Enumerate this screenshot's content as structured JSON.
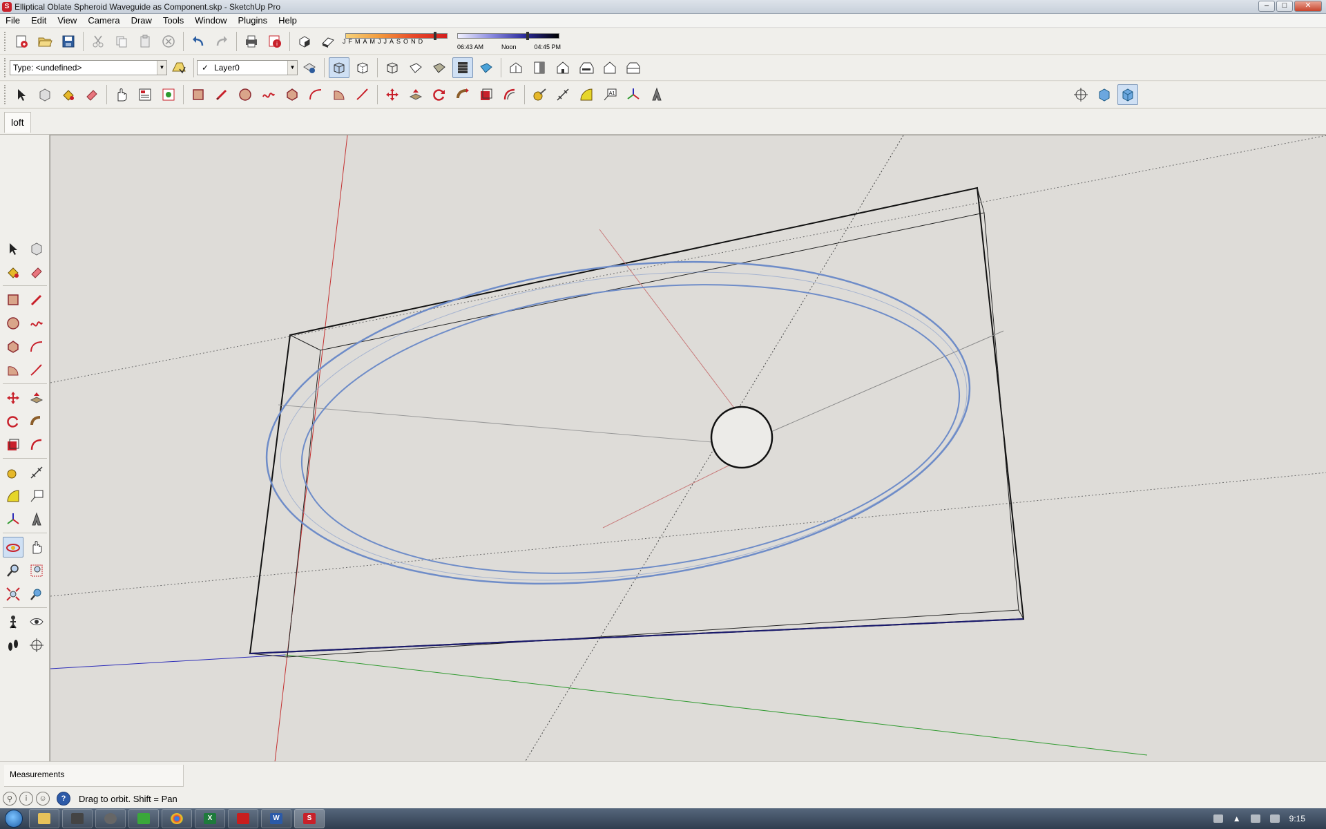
{
  "window": {
    "title": "Elliptical Oblate Spheroid Waveguide as Component.skp - SketchUp Pro",
    "minimize": "–",
    "maximize": "□",
    "close": "✕"
  },
  "menu": [
    "File",
    "Edit",
    "View",
    "Camera",
    "Draw",
    "Tools",
    "Window",
    "Plugins",
    "Help"
  ],
  "shadows": {
    "months": [
      "J",
      "F",
      "M",
      "A",
      "M",
      "J",
      "J",
      "A",
      "S",
      "O",
      "N",
      "D"
    ],
    "time_start": "06:43 AM",
    "time_mid": "Noon",
    "time_end": "04:45 PM"
  },
  "entity_info": {
    "type_label": "Type: <undefined>"
  },
  "layers": {
    "current": "Layer0",
    "checkmark": "✓"
  },
  "scene_tab": "loft",
  "measurements_label": "Measurements",
  "status_text": "Drag to orbit.  Shift = Pan",
  "taskbar": {
    "clock": "9:15",
    "apps": [
      "explorer",
      "totalcmd",
      "cam",
      "vuze",
      "chrome",
      "excel",
      "acrobat",
      "word",
      "sketchup"
    ]
  },
  "colors": {
    "viewport_bg": "#dedcd8",
    "axis_red": "#c43030",
    "axis_green": "#2e9a2e",
    "axis_blue": "#2a2ab8",
    "ellipse": "#6e8cc8"
  }
}
